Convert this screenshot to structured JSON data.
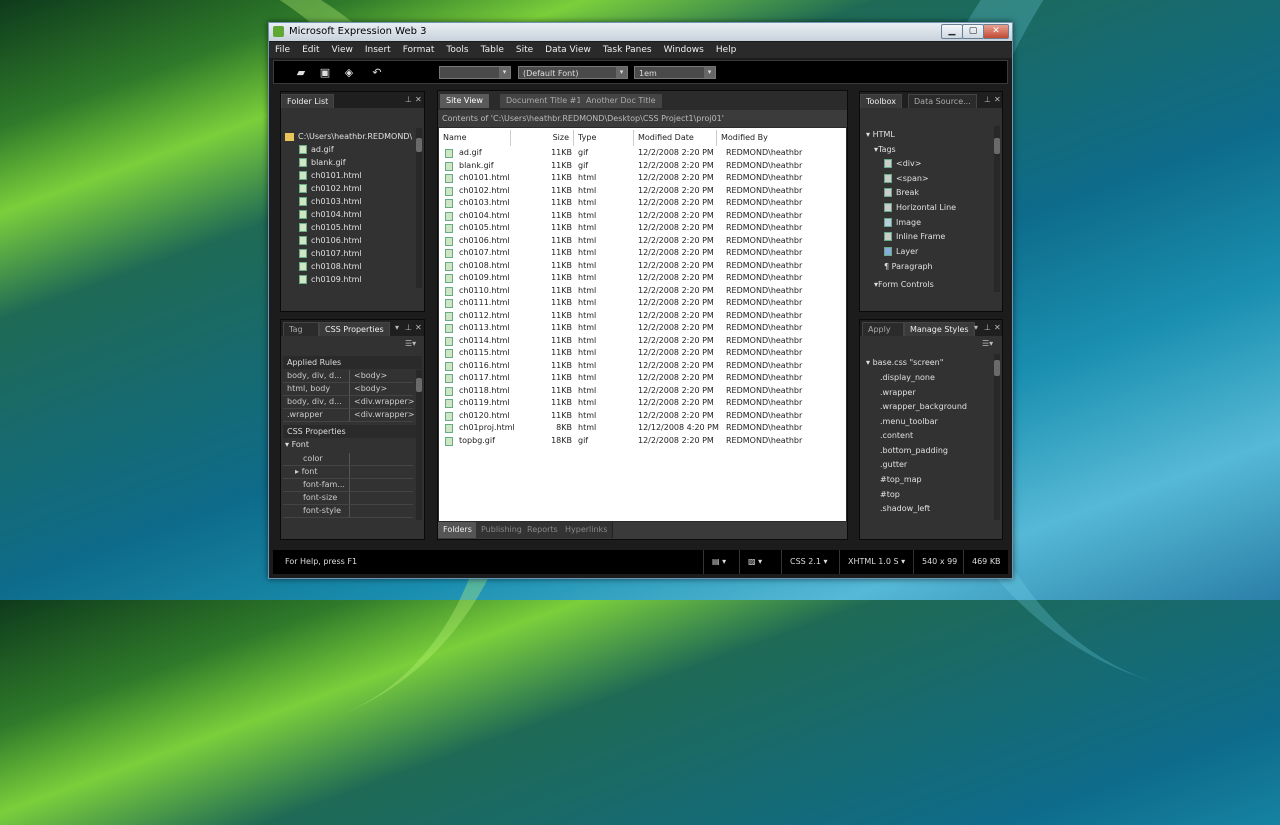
{
  "window": {
    "title": "Microsoft Expression Web 3",
    "min_glyph": "▁",
    "max_glyph": "▢",
    "close_glyph": "✕"
  },
  "menu": [
    "File",
    "Edit",
    "View",
    "Insert",
    "Format",
    "Tools",
    "Table",
    "Site",
    "Data View",
    "Task Panes",
    "Windows",
    "Help"
  ],
  "toolbar": {
    "style_combo": "",
    "font_combo": "(Default Font)",
    "size_combo": "1em",
    "dropdown_glyph": "▾",
    "icons": [
      "folder-open-icon",
      "publish-icon",
      "new-folder-icon",
      "undo-icon"
    ]
  },
  "folder_list": {
    "tab": "Folder List",
    "root": "C:\\Users\\heathbr.REDMOND\\",
    "items": [
      "ad.gif",
      "blank.gif",
      "ch0101.html",
      "ch0102.html",
      "ch0103.html",
      "ch0104.html",
      "ch0105.html",
      "ch0106.html",
      "ch0107.html",
      "ch0108.html",
      "ch0109.html"
    ]
  },
  "css_panel": {
    "tab_inactive": "Tag Prop",
    "tab_active": "CSS Properties",
    "applied_rules_header": "Applied Rules",
    "rules": [
      {
        "sel": "body, div, d...",
        "tag": "<body>"
      },
      {
        "sel": "html, body",
        "tag": "<body>"
      },
      {
        "sel": "body, div, d...",
        "tag": "<div.wrapper>"
      },
      {
        "sel": ".wrapper",
        "tag": "<div.wrapper>"
      }
    ],
    "props_header": "CSS Properties",
    "font_group": "Font",
    "props": [
      "color",
      "font",
      "font-fam...",
      "font-size",
      "font-style"
    ]
  },
  "doc": {
    "tabs": [
      "Site View",
      "Document Title #1",
      "Another Doc Title"
    ],
    "path": "Contents of 'C:\\Users\\heathbr.REDMOND\\Desktop\\CSS Project1\\proj01'",
    "columns": [
      "Name",
      "Size",
      "Type",
      "Modified Date",
      "Modified By"
    ],
    "rows": [
      [
        "ad.gif",
        "11KB",
        "gif",
        "12/2/2008 2:20 PM",
        "REDMOND\\heathbr"
      ],
      [
        "blank.gif",
        "11KB",
        "gif",
        "12/2/2008 2:20 PM",
        "REDMOND\\heathbr"
      ],
      [
        "ch0101.html",
        "11KB",
        "html",
        "12/2/2008 2:20 PM",
        "REDMOND\\heathbr"
      ],
      [
        "ch0102.html",
        "11KB",
        "html",
        "12/2/2008 2:20 PM",
        "REDMOND\\heathbr"
      ],
      [
        "ch0103.html",
        "11KB",
        "html",
        "12/2/2008 2:20 PM",
        "REDMOND\\heathbr"
      ],
      [
        "ch0104.html",
        "11KB",
        "html",
        "12/2/2008 2:20 PM",
        "REDMOND\\heathbr"
      ],
      [
        "ch0105.html",
        "11KB",
        "html",
        "12/2/2008 2:20 PM",
        "REDMOND\\heathbr"
      ],
      [
        "ch0106.html",
        "11KB",
        "html",
        "12/2/2008 2:20 PM",
        "REDMOND\\heathbr"
      ],
      [
        "ch0107.html",
        "11KB",
        "html",
        "12/2/2008 2:20 PM",
        "REDMOND\\heathbr"
      ],
      [
        "ch0108.html",
        "11KB",
        "html",
        "12/2/2008 2:20 PM",
        "REDMOND\\heathbr"
      ],
      [
        "ch0109.html",
        "11KB",
        "html",
        "12/2/2008 2:20 PM",
        "REDMOND\\heathbr"
      ],
      [
        "ch0110.html",
        "11KB",
        "html",
        "12/2/2008 2:20 PM",
        "REDMOND\\heathbr"
      ],
      [
        "ch0111.html",
        "11KB",
        "html",
        "12/2/2008 2:20 PM",
        "REDMOND\\heathbr"
      ],
      [
        "ch0112.html",
        "11KB",
        "html",
        "12/2/2008 2:20 PM",
        "REDMOND\\heathbr"
      ],
      [
        "ch0113.html",
        "11KB",
        "html",
        "12/2/2008 2:20 PM",
        "REDMOND\\heathbr"
      ],
      [
        "ch0114.html",
        "11KB",
        "html",
        "12/2/2008 2:20 PM",
        "REDMOND\\heathbr"
      ],
      [
        "ch0115.html",
        "11KB",
        "html",
        "12/2/2008 2:20 PM",
        "REDMOND\\heathbr"
      ],
      [
        "ch0116.html",
        "11KB",
        "html",
        "12/2/2008 2:20 PM",
        "REDMOND\\heathbr"
      ],
      [
        "ch0117.html",
        "11KB",
        "html",
        "12/2/2008 2:20 PM",
        "REDMOND\\heathbr"
      ],
      [
        "ch0118.html",
        "11KB",
        "html",
        "12/2/2008 2:20 PM",
        "REDMOND\\heathbr"
      ],
      [
        "ch0119.html",
        "11KB",
        "html",
        "12/2/2008 2:20 PM",
        "REDMOND\\heathbr"
      ],
      [
        "ch0120.html",
        "11KB",
        "html",
        "12/2/2008 2:20 PM",
        "REDMOND\\heathbr"
      ],
      [
        "ch01proj.html",
        "8KB",
        "html",
        "12/12/2008 4:20 PM",
        "REDMOND\\heathbr"
      ],
      [
        "topbg.gif",
        "18KB",
        "gif",
        "12/2/2008 2:20 PM",
        "REDMOND\\heathbr"
      ]
    ],
    "bottom_tabs": [
      "Folders",
      "Publishing",
      "Reports",
      "Hyperlinks"
    ]
  },
  "toolbox": {
    "tabs": [
      "Toolbox",
      "Data Source..."
    ],
    "group": "HTML",
    "subgroup": "Tags",
    "items": [
      "<div>",
      "<span>",
      "Break",
      "Horizontal Line",
      "Image",
      "Inline Frame",
      "Layer",
      "Paragraph"
    ],
    "more": "Form Controls"
  },
  "styles": {
    "tabs": [
      "Apply Styles",
      "Manage Styles"
    ],
    "sheet": "base.css \"screen\"",
    "items": [
      ".display_none",
      ".wrapper",
      ".wrapper_background",
      ".menu_toolbar",
      ".content",
      ".bottom_padding",
      ".gutter",
      "#top_map",
      "#top",
      ".shadow_left"
    ]
  },
  "status": {
    "help": "For Help, press F1",
    "css": "CSS 2.1",
    "doctype": "XHTML 1.0 S",
    "dims": "540 x 99",
    "size": "469 KB"
  },
  "colors": {
    "accent": "#5fa833",
    "chrome": "#1c1c1c",
    "panel": "#323232"
  }
}
